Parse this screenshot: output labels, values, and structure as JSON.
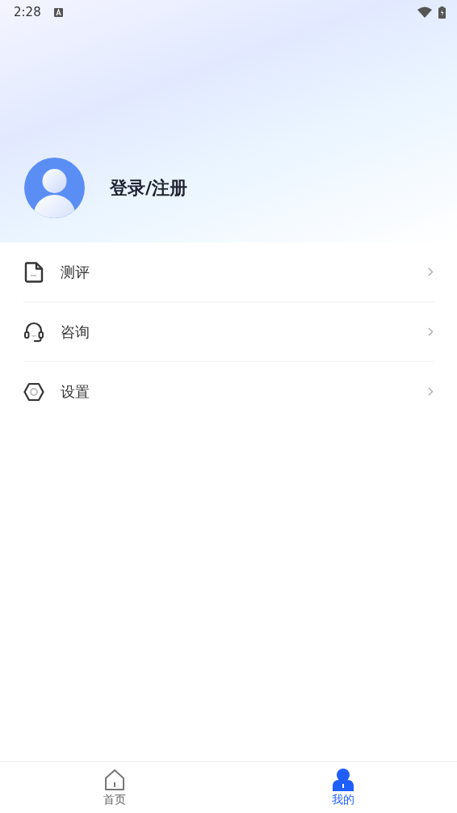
{
  "status_bar": {
    "time": "2:28"
  },
  "profile": {
    "name": "登录/注册"
  },
  "menu": [
    {
      "kind": "document",
      "label": "测评"
    },
    {
      "kind": "headset",
      "label": "咨询"
    },
    {
      "kind": "settings",
      "label": "设置"
    }
  ],
  "tabs": [
    {
      "kind": "home",
      "label": "首页",
      "selected": false
    },
    {
      "kind": "person",
      "label": "我的",
      "selected": true
    }
  ]
}
